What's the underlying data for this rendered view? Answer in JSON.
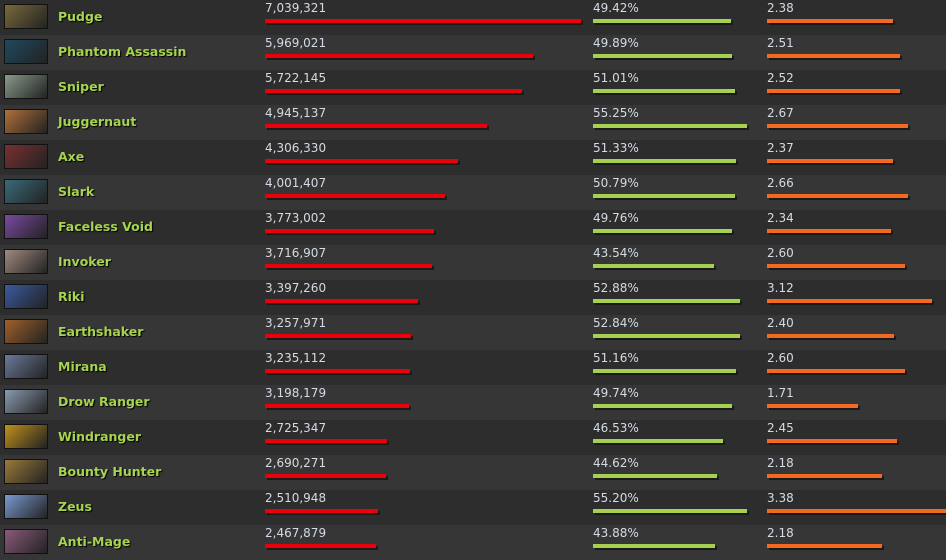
{
  "colors": {
    "name": "#a6d44f",
    "matches_bar": "#e8000b",
    "winrate_bar": "#a6d051",
    "kda_bar": "#f26a21"
  },
  "heroes": [
    {
      "name": "Pudge",
      "matches": "7,039,321",
      "m": 7039321,
      "winrate": "49.42%",
      "w": 49.42,
      "kda": "2.38",
      "k": 2.38,
      "icon": "#7a6a3a"
    },
    {
      "name": "Phantom Assassin",
      "matches": "5,969,021",
      "m": 5969021,
      "winrate": "49.89%",
      "w": 49.89,
      "kda": "2.51",
      "k": 2.51,
      "icon": "#1f4a5e"
    },
    {
      "name": "Sniper",
      "matches": "5,722,145",
      "m": 5722145,
      "winrate": "51.01%",
      "w": 51.01,
      "kda": "2.52",
      "k": 2.52,
      "icon": "#8a9a8a"
    },
    {
      "name": "Juggernaut",
      "matches": "4,945,137",
      "m": 4945137,
      "winrate": "55.25%",
      "w": 55.25,
      "kda": "2.67",
      "k": 2.67,
      "icon": "#b0703a"
    },
    {
      "name": "Axe",
      "matches": "4,306,330",
      "m": 4306330,
      "winrate": "51.33%",
      "w": 51.33,
      "kda": "2.37",
      "k": 2.37,
      "icon": "#7a3030"
    },
    {
      "name": "Slark",
      "matches": "4,001,407",
      "m": 4001407,
      "winrate": "50.79%",
      "w": 50.79,
      "kda": "2.66",
      "k": 2.66,
      "icon": "#3a6a7a"
    },
    {
      "name": "Faceless Void",
      "matches": "3,773,002",
      "m": 3773002,
      "winrate": "49.76%",
      "w": 49.76,
      "kda": "2.34",
      "k": 2.34,
      "icon": "#7a4aa0"
    },
    {
      "name": "Invoker",
      "matches": "3,716,907",
      "m": 3716907,
      "winrate": "43.54%",
      "w": 43.54,
      "kda": "2.60",
      "k": 2.6,
      "icon": "#a08a80"
    },
    {
      "name": "Riki",
      "matches": "3,397,260",
      "m": 3397260,
      "winrate": "52.88%",
      "w": 52.88,
      "kda": "3.12",
      "k": 3.12,
      "icon": "#3a5aa0"
    },
    {
      "name": "Earthshaker",
      "matches": "3,257,971",
      "m": 3257971,
      "winrate": "52.84%",
      "w": 52.84,
      "kda": "2.40",
      "k": 2.4,
      "icon": "#a0602a"
    },
    {
      "name": "Mirana",
      "matches": "3,235,112",
      "m": 3235112,
      "winrate": "51.16%",
      "w": 51.16,
      "kda": "2.60",
      "k": 2.6,
      "icon": "#6a7a9a"
    },
    {
      "name": "Drow Ranger",
      "matches": "3,198,179",
      "m": 3198179,
      "winrate": "49.74%",
      "w": 49.74,
      "kda": "1.71",
      "k": 1.71,
      "icon": "#8a9ab0"
    },
    {
      "name": "Windranger",
      "matches": "2,725,347",
      "m": 2725347,
      "winrate": "46.53%",
      "w": 46.53,
      "kda": "2.45",
      "k": 2.45,
      "icon": "#c0901a"
    },
    {
      "name": "Bounty Hunter",
      "matches": "2,690,271",
      "m": 2690271,
      "winrate": "44.62%",
      "w": 44.62,
      "kda": "2.18",
      "k": 2.18,
      "icon": "#9a7a3a"
    },
    {
      "name": "Zeus",
      "matches": "2,510,948",
      "m": 2510948,
      "winrate": "55.20%",
      "w": 55.2,
      "kda": "3.38",
      "k": 3.38,
      "icon": "#7a9ad0"
    },
    {
      "name": "Anti-Mage",
      "matches": "2,467,879",
      "m": 2467879,
      "winrate": "43.88%",
      "w": 43.88,
      "kda": "2.18",
      "k": 2.18,
      "icon": "#8a5a7a"
    }
  ]
}
